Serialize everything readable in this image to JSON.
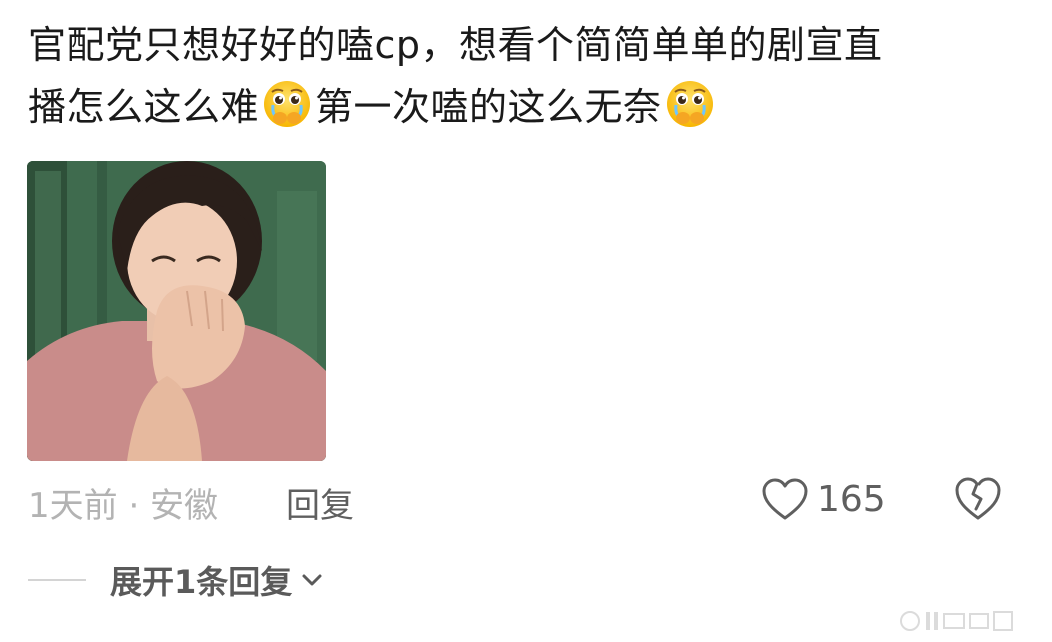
{
  "comment": {
    "line1": "官配党只想好好的嗑cp，想看个简简单单的剧宣直",
    "line2_part1": "播怎么这么难",
    "line2_part2": "第一次嗑的这么无奈",
    "emoji_name": "pleading-face-holding-back-tears"
  },
  "meta": {
    "time_location": "1天前 · 安徽",
    "reply_label": "回复",
    "like_count": "165"
  },
  "replies": {
    "expand_label": "展开1条回复"
  },
  "colors": {
    "text": "#1a1a1a",
    "meta_gray": "#b3b3b3",
    "action_gray": "#5f5f5f",
    "photo_wall": "#3e6a4c",
    "shirt_pink": "#c98c8a"
  }
}
